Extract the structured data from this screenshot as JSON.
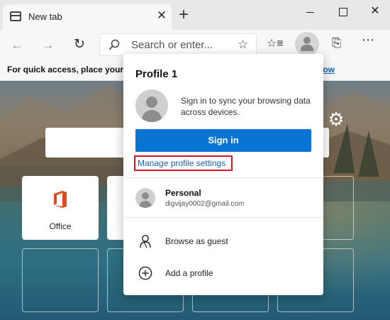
{
  "window": {
    "tab_title": "New tab",
    "tab_close": "✕",
    "new_tab": "+",
    "close": "✕"
  },
  "nav": {
    "back": "←",
    "forward": "→",
    "refresh": "↻",
    "address_placeholder": "Search or enter...",
    "star": "☆",
    "favorites_icon": "☆≡",
    "feedback_icon": "⎘",
    "more": "⋯"
  },
  "favorites_bar": {
    "text": "For quick access, place your fa",
    "link": "low"
  },
  "content": {
    "settings_icon": "⚙",
    "tiles": [
      {
        "label": "Office"
      }
    ]
  },
  "profile_flyout": {
    "title": "Profile 1",
    "signin_text": "Sign in to sync your browsing data across devices.",
    "signin_button": "Sign in",
    "manage_link": "Manage profile settings",
    "account": {
      "name": "Personal",
      "email": "digvijay0002@gmail.com"
    },
    "browse_as_guest": "Browse as guest",
    "add_profile": "Add a profile"
  },
  "colors": {
    "accent": "#0a74d4",
    "highlight_border": "#e0102a",
    "link": "#1a5fb4"
  }
}
